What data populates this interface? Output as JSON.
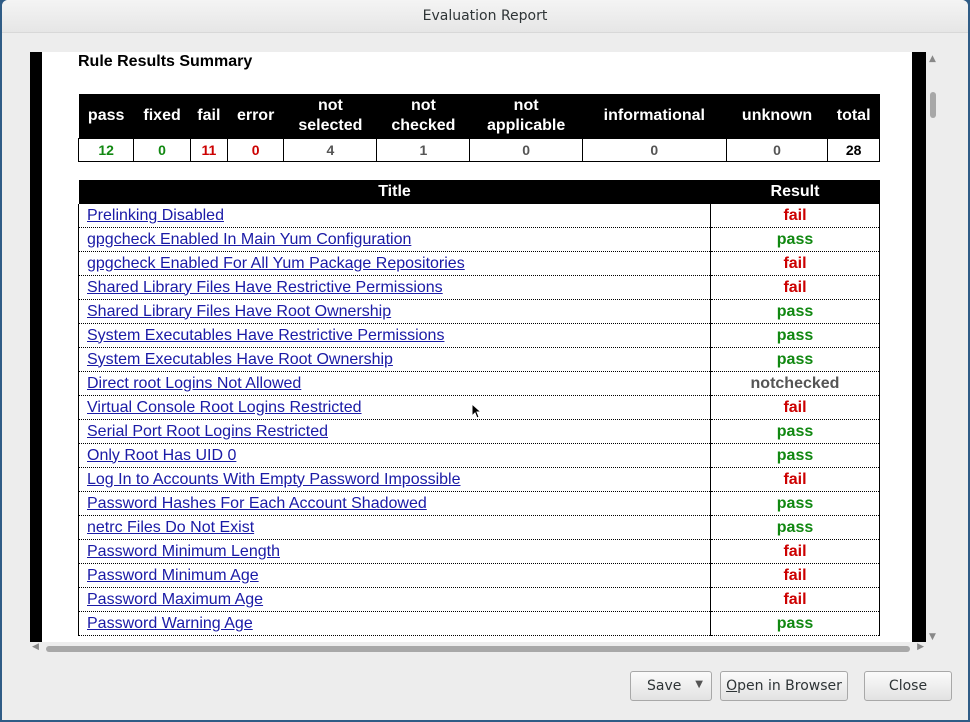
{
  "window": {
    "title": "Evaluation Report"
  },
  "report": {
    "heading": "Rule Results Summary",
    "summary": {
      "headers": [
        [
          "pass"
        ],
        [
          "fixed"
        ],
        [
          "fail"
        ],
        [
          "error"
        ],
        [
          "not",
          "selected"
        ],
        [
          "not",
          "checked"
        ],
        [
          "not",
          "applicable"
        ],
        [
          "informational"
        ],
        [
          "unknown"
        ],
        [
          "total"
        ]
      ],
      "values": [
        "12",
        "0",
        "11",
        "0",
        "4",
        "1",
        "0",
        "0",
        "0",
        "28"
      ],
      "value_colors": [
        "#118811",
        "#118811",
        "#cc0000",
        "#cc0000",
        "#555555",
        "#555555",
        "#555555",
        "#555555",
        "#555555",
        "#000000"
      ]
    },
    "results_table": {
      "headers": {
        "title": "Title",
        "result": "Result"
      },
      "rows": [
        {
          "title": "Prelinking Disabled",
          "result": "fail"
        },
        {
          "title": "gpgcheck Enabled In Main Yum Configuration",
          "result": "pass"
        },
        {
          "title": "gpgcheck Enabled For All Yum Package Repositories",
          "result": "fail"
        },
        {
          "title": "Shared Library Files Have Restrictive Permissions",
          "result": "fail"
        },
        {
          "title": "Shared Library Files Have Root Ownership",
          "result": "pass"
        },
        {
          "title": "System Executables Have Restrictive Permissions",
          "result": "pass"
        },
        {
          "title": "System Executables Have Root Ownership",
          "result": "pass"
        },
        {
          "title": "Direct root Logins Not Allowed",
          "result": "notchecked"
        },
        {
          "title": "Virtual Console Root Logins Restricted",
          "result": "fail"
        },
        {
          "title": "Serial Port Root Logins Restricted",
          "result": "pass"
        },
        {
          "title": "Only Root Has UID 0",
          "result": "pass"
        },
        {
          "title": "Log In to Accounts With Empty Password Impossible",
          "result": "fail"
        },
        {
          "title": "Password Hashes For Each Account Shadowed",
          "result": "pass"
        },
        {
          "title": "netrc Files Do Not Exist",
          "result": "pass"
        },
        {
          "title": "Password Minimum Length",
          "result": "fail"
        },
        {
          "title": "Password Minimum Age",
          "result": "fail"
        },
        {
          "title": "Password Maximum Age",
          "result": "fail"
        },
        {
          "title": "Password Warning Age",
          "result": "pass"
        }
      ]
    },
    "result_colors": {
      "pass": "#118811",
      "fail": "#cc0000",
      "notchecked": "#555555"
    }
  },
  "buttons": {
    "save_label": "Save",
    "open_browser_mnemonic": "O",
    "open_browser_rest": "pen in Browser",
    "close_label": "Close"
  },
  "icons": {
    "save_dropdown": "chevron-down-icon",
    "scroll_up": "arrow-up-icon",
    "scroll_down": "arrow-down-icon",
    "scroll_left": "arrow-left-icon",
    "scroll_right": "arrow-right-icon",
    "cursor": "mouse-pointer-icon"
  }
}
